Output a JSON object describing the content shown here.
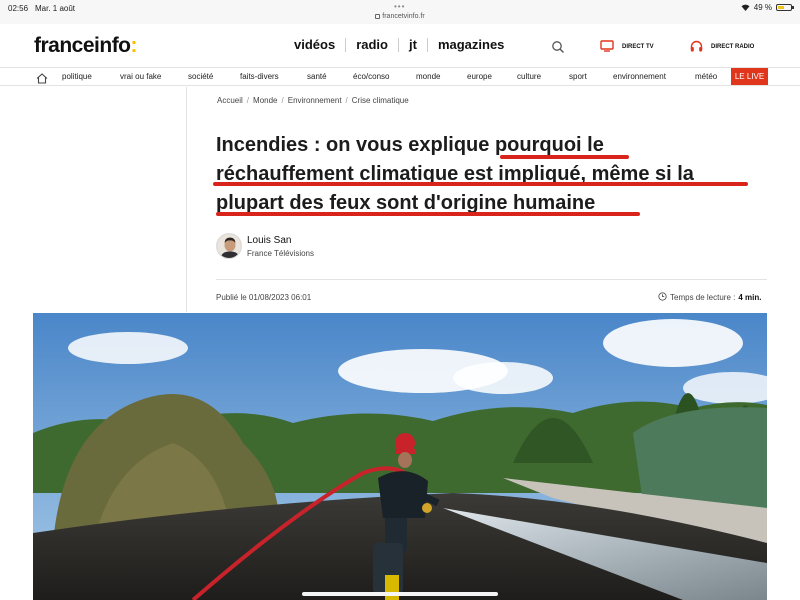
{
  "status_bar": {
    "time": "02:56",
    "date": "Mar. 1 août",
    "url": "francetvinfo.fr",
    "battery": "49 %",
    "battery_level": 0.49
  },
  "header": {
    "logo_text": "franceinfo",
    "logo_colon": ":",
    "nav": [
      "vidéos",
      "radio",
      "jt",
      "magazines"
    ],
    "direct_tv": "DIRECT TV",
    "direct_radio": "DIRECT RADIO"
  },
  "categories": [
    "politique",
    "vrai ou fake",
    "société",
    "faits-divers",
    "santé",
    "éco/conso",
    "monde",
    "europe",
    "culture",
    "sport",
    "environnement",
    "météo"
  ],
  "live_label": "LE LIVE",
  "breadcrumb": [
    "Accueil",
    "Monde",
    "Environnement",
    "Crise climatique"
  ],
  "article": {
    "title_lines": [
      "Incendies : on vous explique pourquoi le",
      "réchauffement climatique est impliqué, même si la",
      "plupart des feux sont d'origine humaine"
    ],
    "author_name": "Louis San",
    "author_org": "France Télévisions",
    "published": "Publié le 01/08/2023 06:01",
    "reading_label": "Temps de lecture :",
    "reading_time": "4 min."
  },
  "colors": {
    "accent_red": "#d9241c",
    "live_red": "#e0361c",
    "logo_yellow": "#f6c000"
  }
}
